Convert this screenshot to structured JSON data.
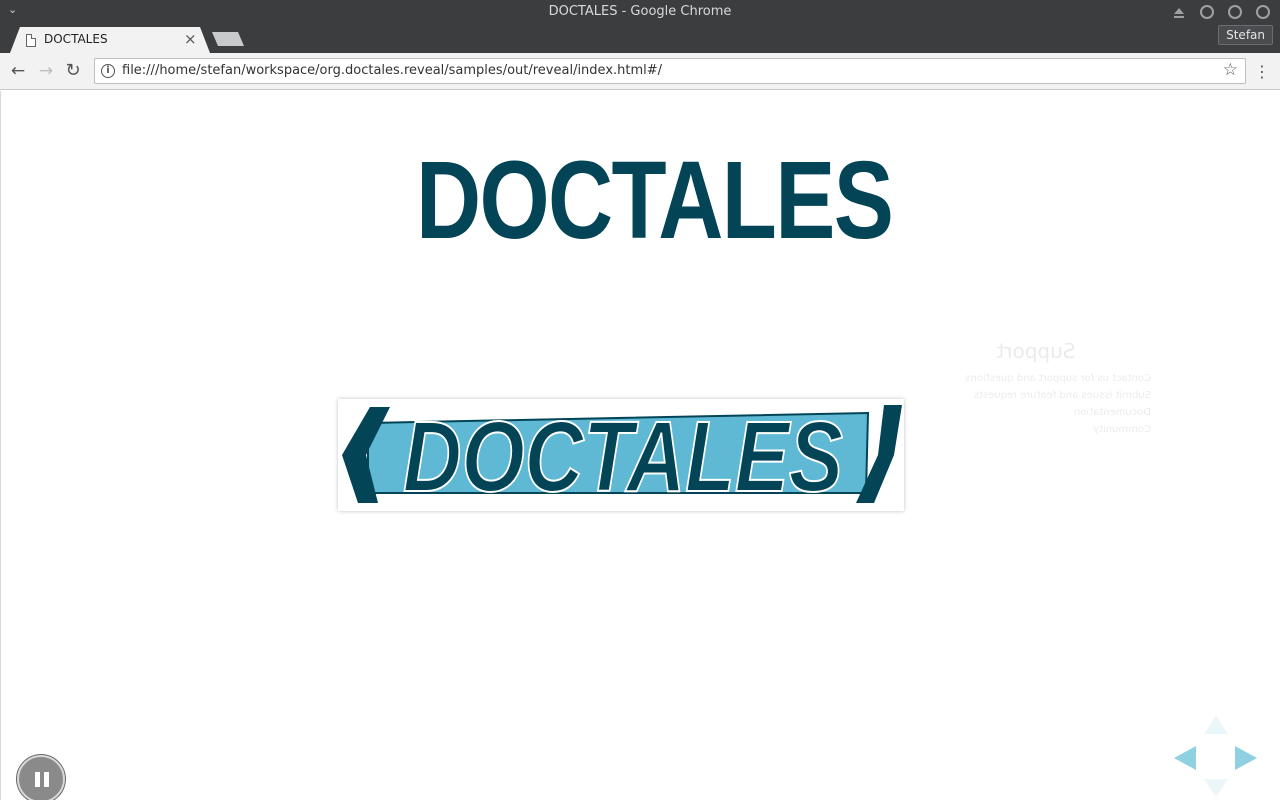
{
  "window": {
    "title": "DOCTALES - Google Chrome"
  },
  "tabs": [
    {
      "label": "DOCTALES",
      "close": "×"
    }
  ],
  "profile": {
    "name": "Stefan"
  },
  "toolbar": {
    "back": "←",
    "forward": "→",
    "reload": "↻",
    "url": "file:///home/stefan/workspace/org.doctales.reveal/samples/out/reveal/index.html#/",
    "info_icon": "i",
    "bookmark": "☆",
    "menu": "⋮"
  },
  "slide": {
    "headline": "DOCTALES",
    "logo_text": "DOCTALES",
    "colors": {
      "headline": "#034457",
      "logo_band": "#5fb9d5",
      "logo_text": "#034457",
      "nav_arrow": "#8fd1e1"
    }
  },
  "background_slide": {
    "title": "Support",
    "lines": [
      "Contact us for support and questions",
      "Submit issues and feature requests",
      "Documentation",
      "Community"
    ]
  }
}
